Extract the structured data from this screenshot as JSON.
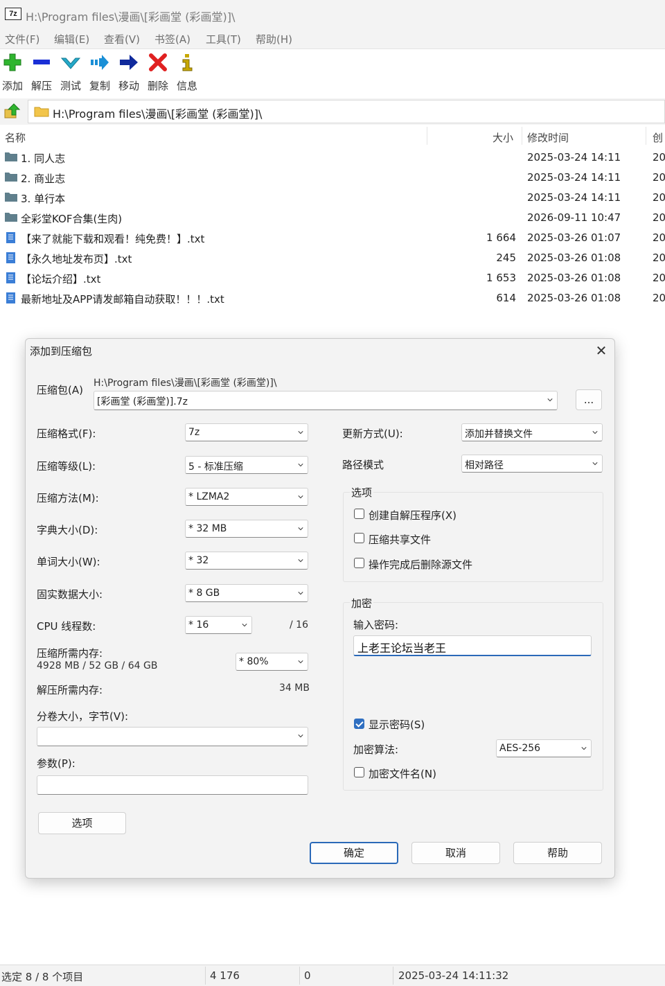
{
  "window": {
    "app_icon": "7z",
    "title": "H:\\Program files\\漫画\\[彩画堂 (彩画堂)]\\"
  },
  "menu": [
    "文件(F)",
    "编辑(E)",
    "查看(V)",
    "书签(A)",
    "工具(T)",
    "帮助(H)"
  ],
  "toolbar": [
    {
      "label": "添加",
      "icon": "plus-icon",
      "color": "#2fb52f"
    },
    {
      "label": "解压",
      "icon": "minus-icon",
      "color": "#1a2fd6"
    },
    {
      "label": "测试",
      "icon": "check-icon",
      "color": "#25a9c9"
    },
    {
      "label": "复制",
      "icon": "copy-arrow-icon",
      "color": "#1a8fd6"
    },
    {
      "label": "移动",
      "icon": "move-arrow-icon",
      "color": "#102a9c"
    },
    {
      "label": "删除",
      "icon": "delete-x-icon",
      "color": "#e02020"
    },
    {
      "label": "信息",
      "icon": "info-icon",
      "color": "#c8a800"
    }
  ],
  "address": {
    "path": "H:\\Program files\\漫画\\[彩画堂 (彩画堂)]\\"
  },
  "columns": {
    "name": "名称",
    "size": "大小",
    "modified": "修改时间",
    "created": "创"
  },
  "files": [
    {
      "name": "1. 同人志",
      "size": "",
      "modified": "2025-03-24 14:11",
      "created": "20",
      "type": "folder"
    },
    {
      "name": "2. 商业志",
      "size": "",
      "modified": "2025-03-24 14:11",
      "created": "20",
      "type": "folder"
    },
    {
      "name": "3. 单行本",
      "size": "",
      "modified": "2025-03-24 14:11",
      "created": "20",
      "type": "folder"
    },
    {
      "name": "全彩堂KOF合集(生肉)",
      "size": "",
      "modified": "2026-09-11 10:47",
      "created": "20",
      "type": "folder"
    },
    {
      "name": "【来了就能下载和观看！纯免费！】.txt",
      "size": "1 664",
      "modified": "2025-03-26 01:07",
      "created": "20",
      "type": "file"
    },
    {
      "name": "【永久地址发布页】.txt",
      "size": "245",
      "modified": "2025-03-26 01:08",
      "created": "20",
      "type": "file"
    },
    {
      "name": "【论坛介绍】.txt",
      "size": "1 653",
      "modified": "2025-03-26 01:08",
      "created": "20",
      "type": "file"
    },
    {
      "name": "最新地址及APP请发邮箱自动获取！！！.txt",
      "size": "614",
      "modified": "2025-03-26 01:08",
      "created": "20",
      "type": "file"
    }
  ],
  "dialog": {
    "title": "添加到压缩包",
    "archive_label": "压缩包(A)",
    "archive_dir": "H:\\Program files\\漫画\\[彩画堂 (彩画堂)]\\",
    "archive_name": "[彩画堂 (彩画堂)].7z",
    "browse_label": "...",
    "format_label": "压缩格式(F):",
    "format_value": "7z",
    "level_label": "压缩等级(L):",
    "level_value": "5 - 标准压缩",
    "method_label": "压缩方法(M):",
    "method_value": "* LZMA2",
    "dict_label": "字典大小(D):",
    "dict_value": "* 32 MB",
    "word_label": "单词大小(W):",
    "word_value": "* 32",
    "solid_label": "固实数据大小:",
    "solid_value": "* 8 GB",
    "cpu_label": "CPU 线程数:",
    "cpu_value": "* 16",
    "cpu_max": "/ 16",
    "mem_label": "压缩所需内存:",
    "mem_detail": "4928 MB / 52 GB / 64 GB",
    "mem_percent": "* 80%",
    "decomp_label": "解压所需内存:",
    "decomp_value": "34 MB",
    "split_label": "分卷大小，字节(V):",
    "split_value": "",
    "params_label": "参数(P):",
    "params_value": "",
    "options_button": "选项",
    "update_label": "更新方式(U):",
    "update_value": "添加并替换文件",
    "path_label": "路径模式",
    "path_value": "相对路径",
    "options_group": "选项",
    "opt_sfx": "创建自解压程序(X)",
    "opt_sfx_checked": false,
    "opt_shared": "压缩共享文件",
    "opt_shared_checked": false,
    "opt_delete": "操作完成后删除源文件",
    "opt_delete_checked": false,
    "encrypt_group": "加密",
    "password_label": "输入密码:",
    "password_value": "上老王论坛当老王",
    "show_password": "显示密码(S)",
    "show_password_checked": true,
    "enc_method_label": "加密算法:",
    "enc_method_value": "AES-256",
    "enc_names": "加密文件名(N)",
    "enc_names_checked": false,
    "ok": "确定",
    "cancel": "取消",
    "help": "帮助"
  },
  "status": {
    "selected": "选定 8 / 8 个项目",
    "size": "4 176",
    "packed": "0",
    "date": "2025-03-24 14:11:32"
  },
  "colors": {
    "accent": "#2a69b8",
    "checkbox": "#2f6fc1",
    "folder": "#5f7f8c",
    "file": "#3b7ed6"
  }
}
